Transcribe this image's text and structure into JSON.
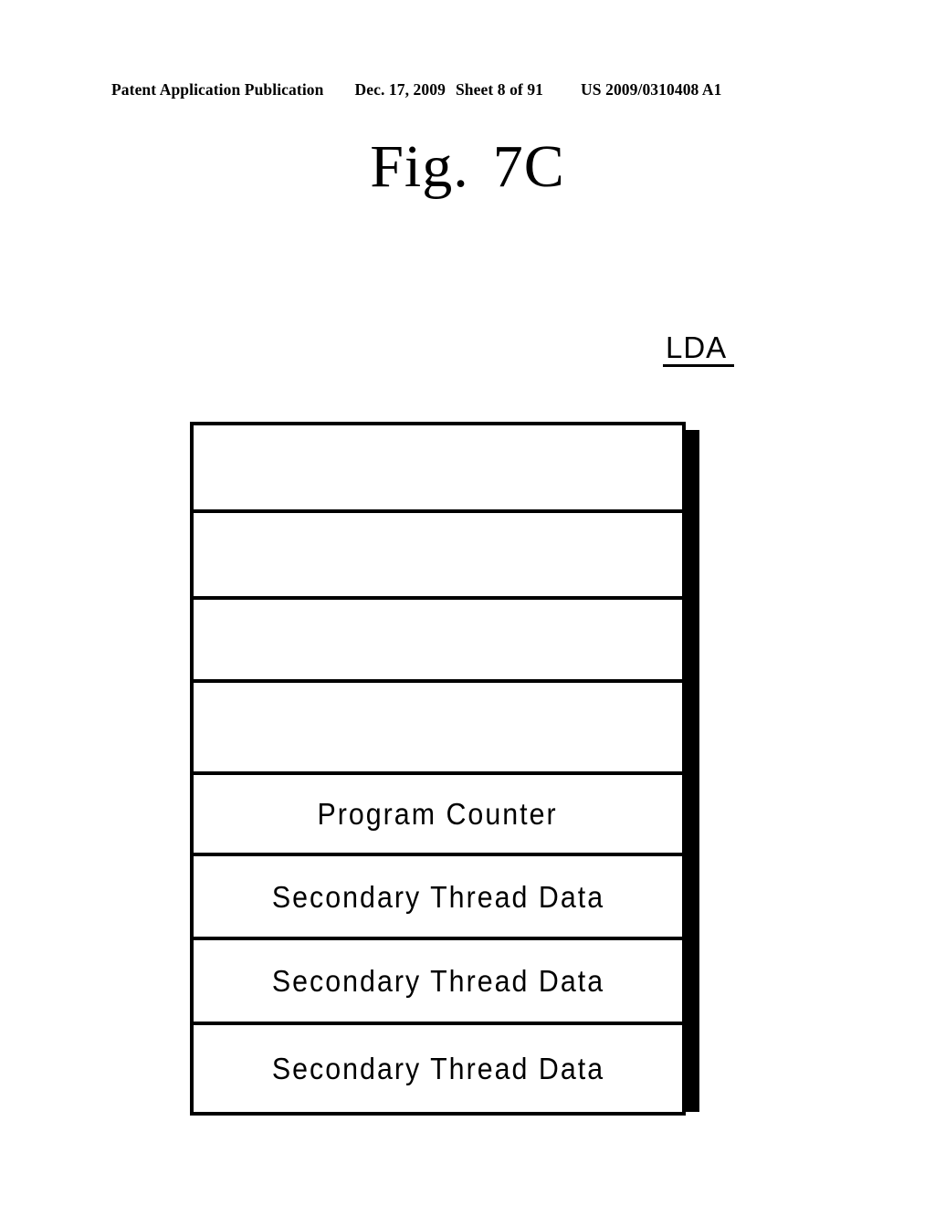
{
  "page_header": {
    "publication": "Patent Application Publication",
    "date": "Dec. 17, 2009",
    "sheet": "Sheet 8 of 91",
    "patent_number": "US 2009/0310408 A1"
  },
  "figure": {
    "title_word": "Fig.",
    "title_number": "7C"
  },
  "diagram": {
    "caption": "LDA",
    "rows": [
      {
        "label": "",
        "empty": true
      },
      {
        "label": "",
        "empty": true
      },
      {
        "label": "",
        "empty": true
      },
      {
        "label": "",
        "empty": true
      },
      {
        "label": "",
        "empty": true
      },
      {
        "label": "Program Counter",
        "empty": false
      },
      {
        "label": "Secondary Thread Data",
        "empty": false
      },
      {
        "label": "Secondary Thread Data",
        "empty": false
      },
      {
        "label": "Secondary Thread Data",
        "empty": false
      }
    ]
  },
  "colors": {
    "ink": "#000000",
    "paper": "#ffffff"
  }
}
